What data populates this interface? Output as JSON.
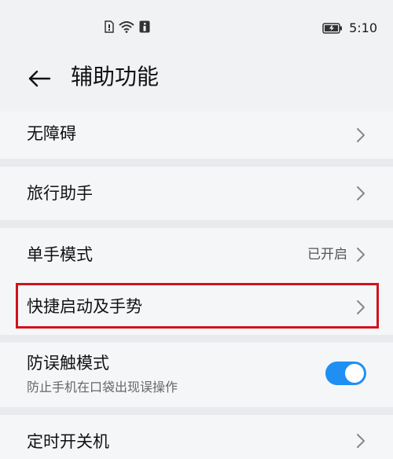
{
  "status_bar": {
    "time": "5:10",
    "icons": [
      "sim-card-icon",
      "wifi-icon",
      "info-icon",
      "battery-charging-icon"
    ]
  },
  "header": {
    "title": "辅助功能",
    "back_icon": "back-arrow-icon"
  },
  "settings": {
    "items": [
      {
        "label": "无障碍",
        "icon": "chevron-right-icon"
      },
      {
        "label": "旅行助手",
        "icon": "chevron-right-icon"
      },
      {
        "label": "单手模式",
        "value": "已开启",
        "icon": "chevron-right-icon"
      },
      {
        "label": "快捷启动及手势",
        "icon": "chevron-right-icon",
        "highlighted": true
      },
      {
        "label": "防误触模式",
        "sublabel": "防止手机在口袋出现误操作",
        "toggle_on": true
      },
      {
        "label": "定时开关机",
        "icon": "chevron-right-icon"
      }
    ]
  },
  "colors": {
    "accent": "#1f8ff4",
    "highlight_border": "#d0131d",
    "background": "#f1f2f4"
  }
}
